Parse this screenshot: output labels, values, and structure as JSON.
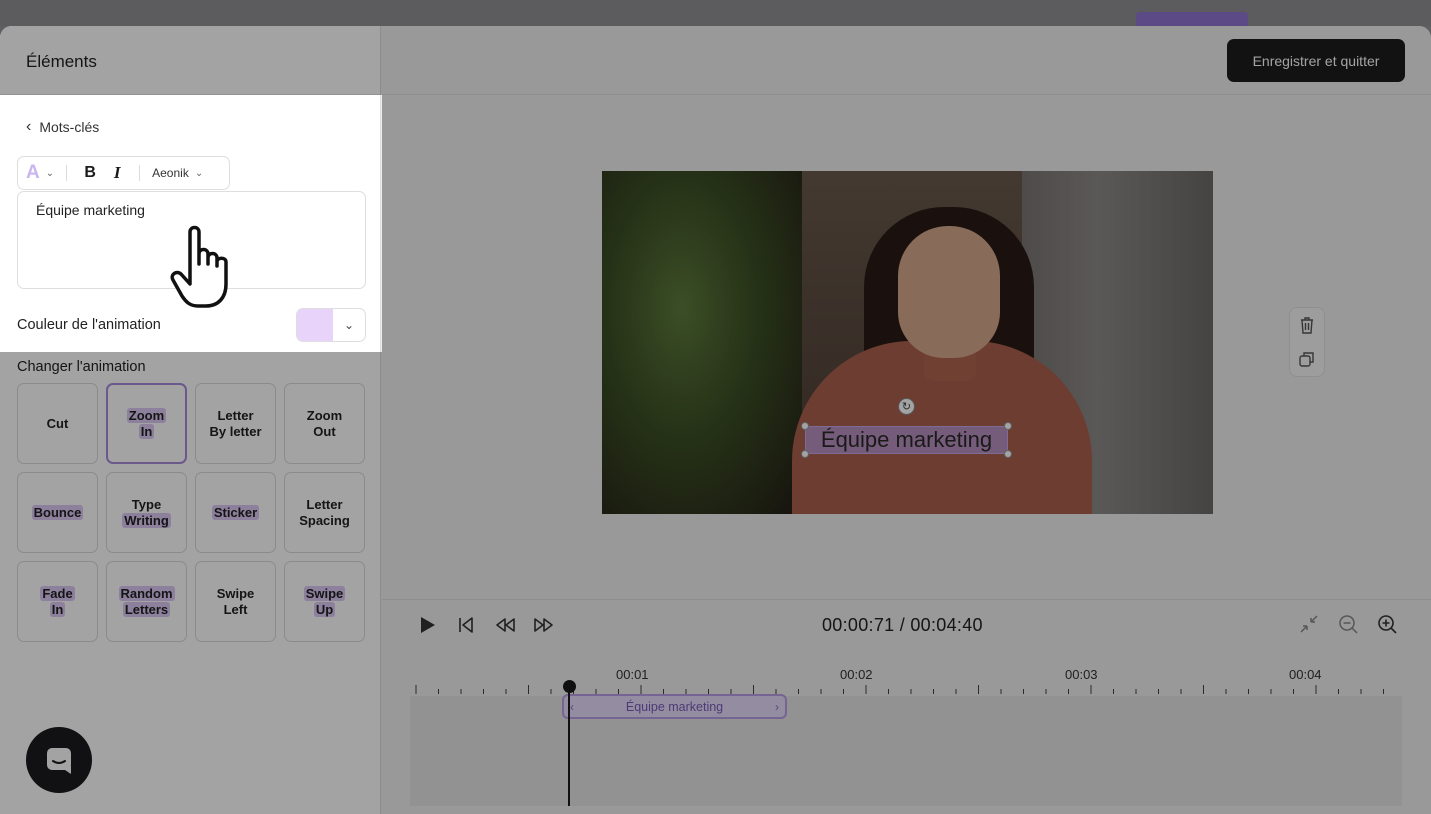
{
  "left_panel": {
    "title": "Éléments",
    "back_label": "Mots-clés",
    "font_name": "Aeonik",
    "text_value": "Équipe marketing",
    "color_label": "Couleur de l'animation",
    "color_value": "#e8d4fb",
    "animation_title": "Changer l'animation",
    "animations": [
      {
        "line1": "Cut",
        "line2": "",
        "selected": false
      },
      {
        "line1": "Zoom",
        "line2": "In",
        "selected": true
      },
      {
        "line1": "Letter",
        "line2": "By letter",
        "selected": false
      },
      {
        "line1": "Zoom",
        "line2": "Out",
        "selected": false
      },
      {
        "line1": "Bounce",
        "line2": "",
        "selected": false
      },
      {
        "line1": "Type",
        "line2": "Writing",
        "selected": false
      },
      {
        "line1": "Sticker",
        "line2": "",
        "selected": false
      },
      {
        "line1": "Letter",
        "line2": "Spacing",
        "selected": false
      },
      {
        "line1": "Fade",
        "line2": "In",
        "selected": false
      },
      {
        "line1": "Random",
        "line2": "Letters",
        "selected": false
      },
      {
        "line1": "Swipe",
        "line2": "Left",
        "selected": false
      },
      {
        "line1": "Swipe",
        "line2": "Up",
        "selected": false
      }
    ]
  },
  "header": {
    "save_label": "Enregistrer et quitter"
  },
  "preview": {
    "caption": "Équipe marketing"
  },
  "player": {
    "timecode": "00:00:71 / 00:04:40"
  },
  "timeline": {
    "ticks": [
      "00:01",
      "00:02",
      "00:03",
      "00:04"
    ],
    "clip_label": "Équipe marketing"
  },
  "colors": {
    "accent": "#b99de6",
    "highlight": "#dcc8f5",
    "dark_button": "#1d1d1f"
  }
}
